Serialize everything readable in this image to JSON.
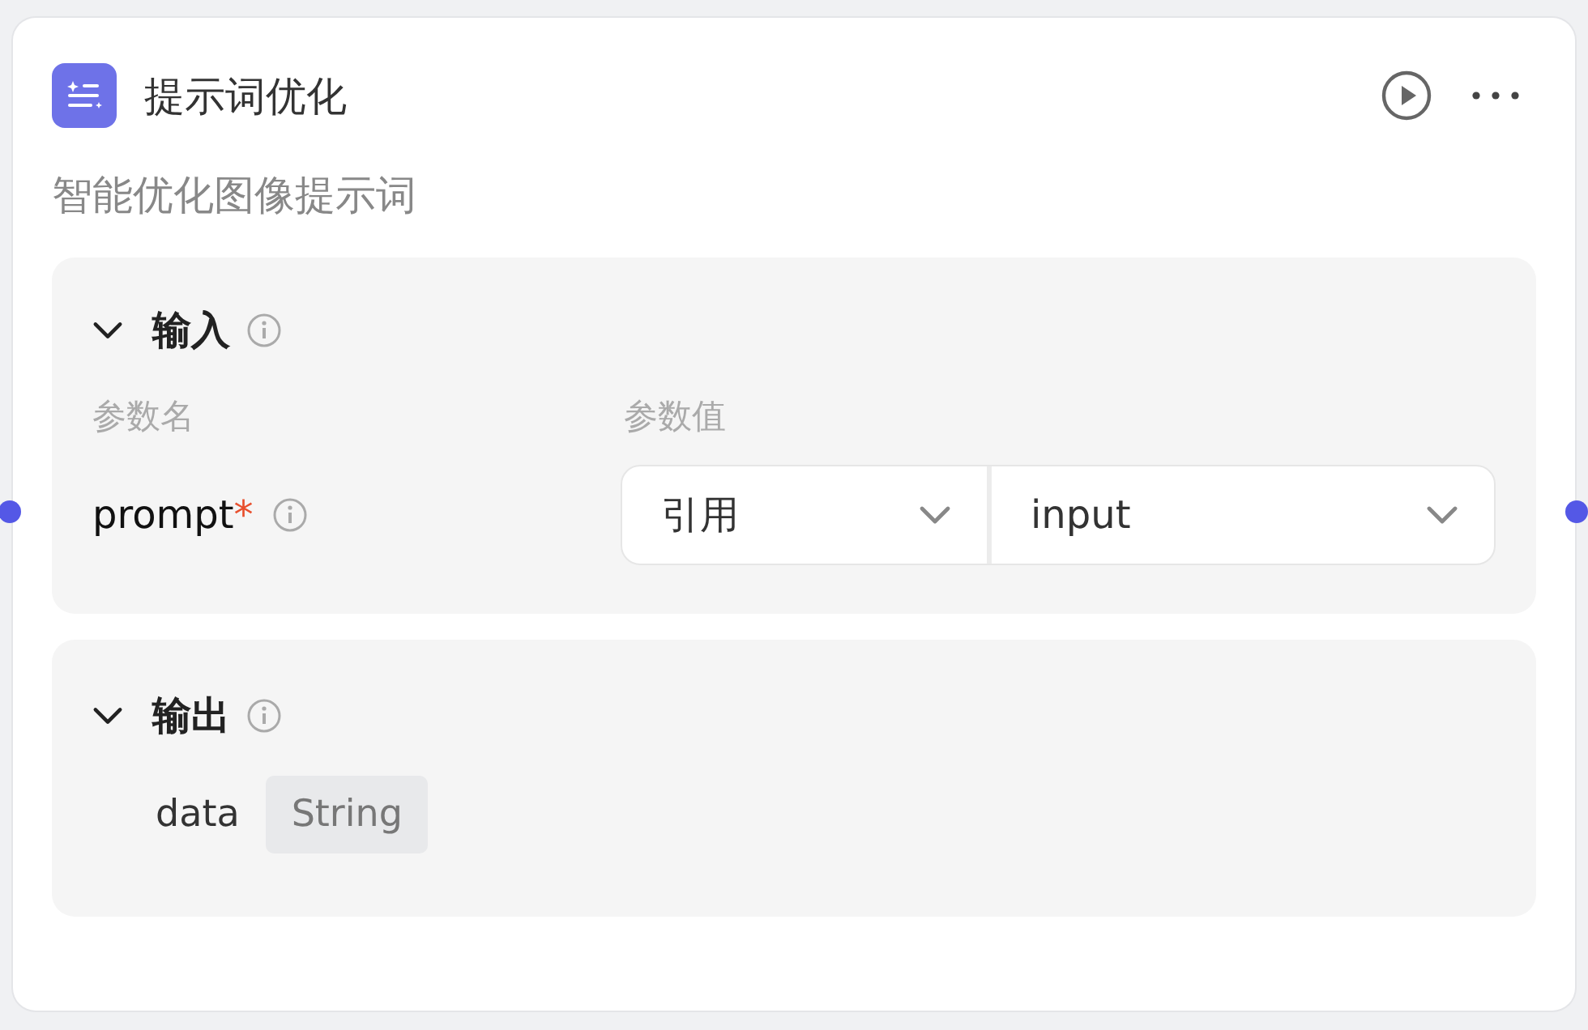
{
  "node": {
    "title": "提示词优化",
    "description": "智能优化图像提示词"
  },
  "input_section": {
    "title": "输入",
    "expanded": true,
    "columns": [
      "参数名",
      "参数值"
    ],
    "params": [
      {
        "name": "prompt",
        "required_mark": "*",
        "source": "引用",
        "value": "input"
      }
    ]
  },
  "output_section": {
    "title": "输出",
    "expanded": true,
    "outputs": [
      {
        "name": "data",
        "type": "String"
      }
    ]
  }
}
